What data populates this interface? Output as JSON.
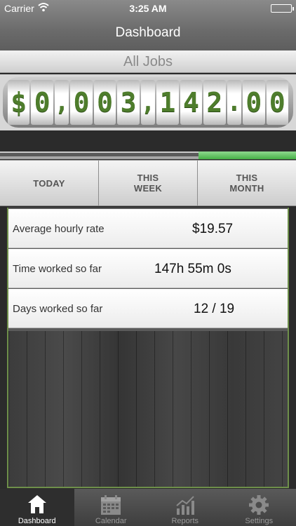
{
  "status_bar": {
    "carrier": "Carrier",
    "time": "3:25 AM"
  },
  "nav": {
    "title": "Dashboard"
  },
  "jobs_filter": {
    "label": "All Jobs"
  },
  "earnings": {
    "digits": [
      "$",
      "0",
      ",",
      "0",
      "0",
      "3",
      ",",
      "1",
      "4",
      "2",
      ".",
      "0",
      "0"
    ],
    "color": "#4e7d2c"
  },
  "progress": {
    "fraction": 0.33,
    "accent": "#46b046"
  },
  "period_tabs": [
    {
      "label": "TODAY"
    },
    {
      "label": "THIS\nWEEK"
    },
    {
      "label": "THIS\nMONTH"
    }
  ],
  "stats": {
    "hourly": {
      "label": "Average hourly rate",
      "value": "$19.57"
    },
    "time": {
      "label": "Time worked so far",
      "value": "147h 55m 0s"
    },
    "days": {
      "label": "Days worked so far",
      "value": "12 / 19"
    }
  },
  "tabbar": {
    "items": [
      {
        "label": "Dashboard",
        "icon": "home-icon"
      },
      {
        "label": "Calendar",
        "icon": "calendar-icon"
      },
      {
        "label": "Reports",
        "icon": "chart-icon"
      },
      {
        "label": "Settings",
        "icon": "gear-icon"
      }
    ]
  }
}
